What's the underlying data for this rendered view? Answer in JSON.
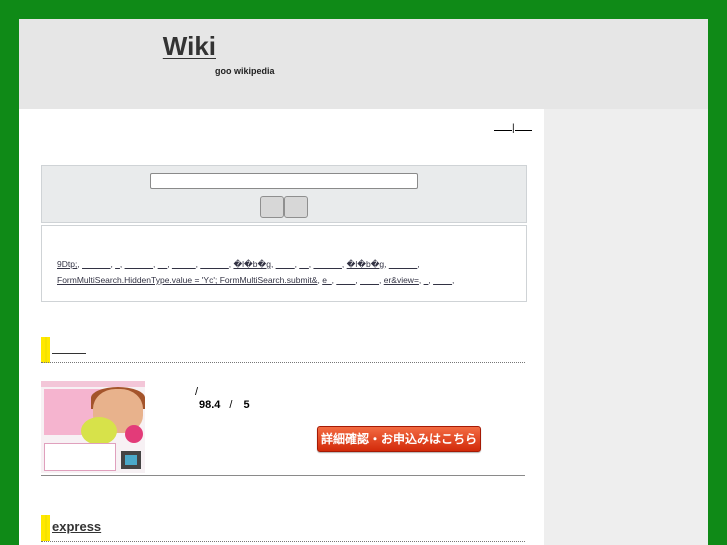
{
  "header": {
    "site_title": "Wiki",
    "site_subtitle": "goo  wikipedia"
  },
  "top_links": {
    "separator": "|"
  },
  "search": {
    "input_value": "",
    "button1_label": "",
    "button2_label": ""
  },
  "keywords": {
    "line1": [
      "9Dtp;",
      "______",
      "_",
      "______",
      "__",
      "_____",
      "______",
      "�l�b�g",
      "____",
      "__",
      "______",
      "�l�b�g",
      "______"
    ],
    "line2": [
      "FormMultiSearch.HiddenType.value = 'Yc'; FormMultiSearch.submit&",
      "e_",
      "____",
      "____",
      "er&view=",
      "_",
      "____"
    ]
  },
  "section1": {
    "title": ""
  },
  "product": {
    "slash": "/",
    "price": "98.4",
    "price_sep": "/",
    "count": "5",
    "detail_button": "詳細確認・お申込みはこちら"
  },
  "section2": {
    "title": "express"
  },
  "colors": {
    "outer_bg": "#0f8a17",
    "header_bg": "#e6e6e6",
    "accent_bar": "#ffe800",
    "button": "#e0421c"
  }
}
